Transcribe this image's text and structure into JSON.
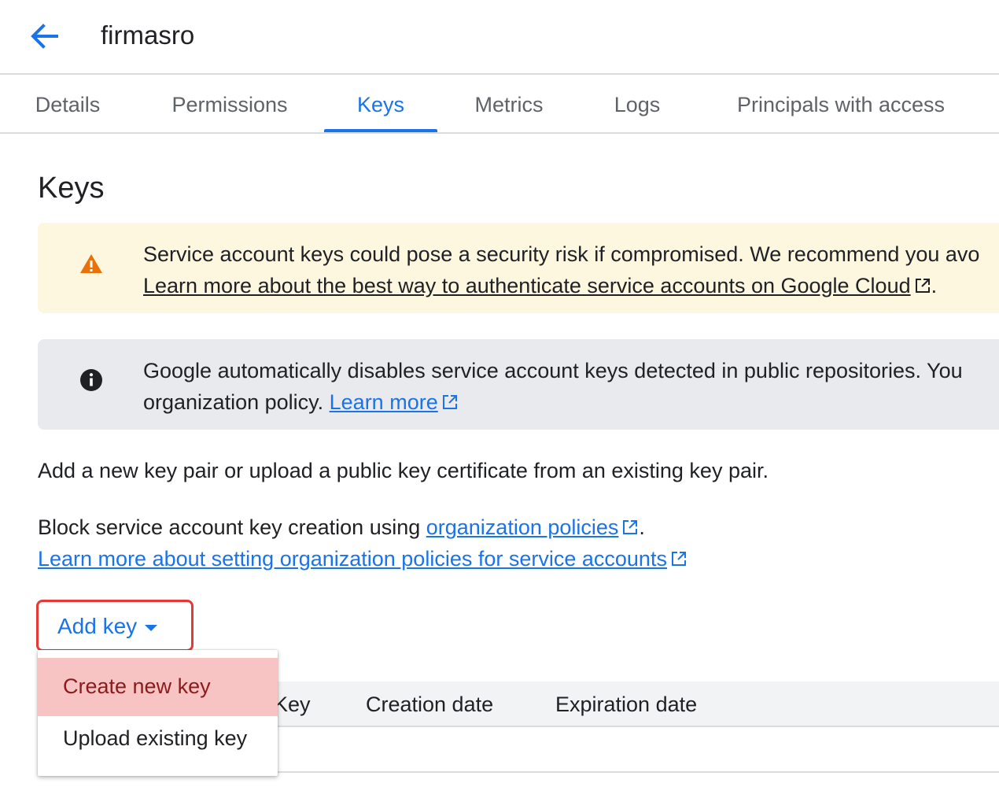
{
  "header": {
    "back_icon": "arrow-back-icon",
    "title": "firmasro"
  },
  "tabs": [
    {
      "label": "Details",
      "active": false
    },
    {
      "label": "Permissions",
      "active": false
    },
    {
      "label": "Keys",
      "active": true
    },
    {
      "label": "Metrics",
      "active": false
    },
    {
      "label": "Logs",
      "active": false
    },
    {
      "label": "Principals with access",
      "active": false
    }
  ],
  "page": {
    "heading": "Keys"
  },
  "warning_banner": {
    "icon": "warning-icon",
    "text": "Service account keys could pose a security risk if compromised. We recommend you avo",
    "link": "Learn more about the best way to authenticate service accounts on Google Cloud",
    "link_suffix": "."
  },
  "info_banner": {
    "icon": "info-icon",
    "text_line1": "Google automatically disables service account keys detected in public repositories. You",
    "text_line2_prefix": "organization policy. ",
    "link": "Learn more"
  },
  "description": "Add a new key pair or upload a public key certificate from an existing key pair.",
  "policy": {
    "prefix": "Block service account key creation using ",
    "link1": "organization policies",
    "suffix": ".",
    "link2": "Learn more about setting organization policies for service accounts"
  },
  "add_key_button": {
    "label": "Add key"
  },
  "dropdown_menu": {
    "items": [
      {
        "label": "Create new key",
        "highlighted": true
      },
      {
        "label": "Upload existing key",
        "highlighted": false
      }
    ]
  },
  "table": {
    "columns": [
      "Key",
      "Creation date",
      "Expiration date"
    ]
  },
  "colors": {
    "accent": "#1a73e8",
    "warning_bg": "#fef7e0",
    "warning_icon": "#e8710a",
    "info_bg": "#e8eaed",
    "highlight_border": "#e53935",
    "menu_highlight": "#f8c3c3"
  }
}
